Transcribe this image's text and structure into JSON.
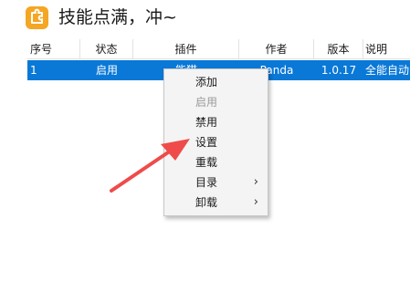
{
  "header": {
    "icon": "puzzle-icon",
    "title": "技能点满，冲~",
    "accent_color": "#f5a623"
  },
  "table": {
    "columns": [
      "序号",
      "状态",
      "插件",
      "作者",
      "版本",
      "说明"
    ],
    "rows": [
      {
        "index": "1",
        "status": "启用",
        "plugin": "能猫",
        "author": "Panda",
        "version": "1.0.17",
        "description": "全能自动"
      }
    ],
    "selected_row_color": "#0a78d7"
  },
  "context_menu": {
    "items": [
      {
        "label": "添加",
        "enabled": true
      },
      {
        "label": "启用",
        "enabled": false
      },
      {
        "label": "禁用",
        "enabled": true
      },
      {
        "label": "设置",
        "enabled": true
      },
      {
        "label": "重载",
        "enabled": true
      },
      {
        "label": "目录",
        "enabled": true,
        "submenu": true
      },
      {
        "label": "卸载",
        "enabled": true,
        "submenu": true
      }
    ],
    "submenu_glyph": "›"
  },
  "annotation": {
    "color": "#ef4b4b",
    "points_to": "设置"
  }
}
